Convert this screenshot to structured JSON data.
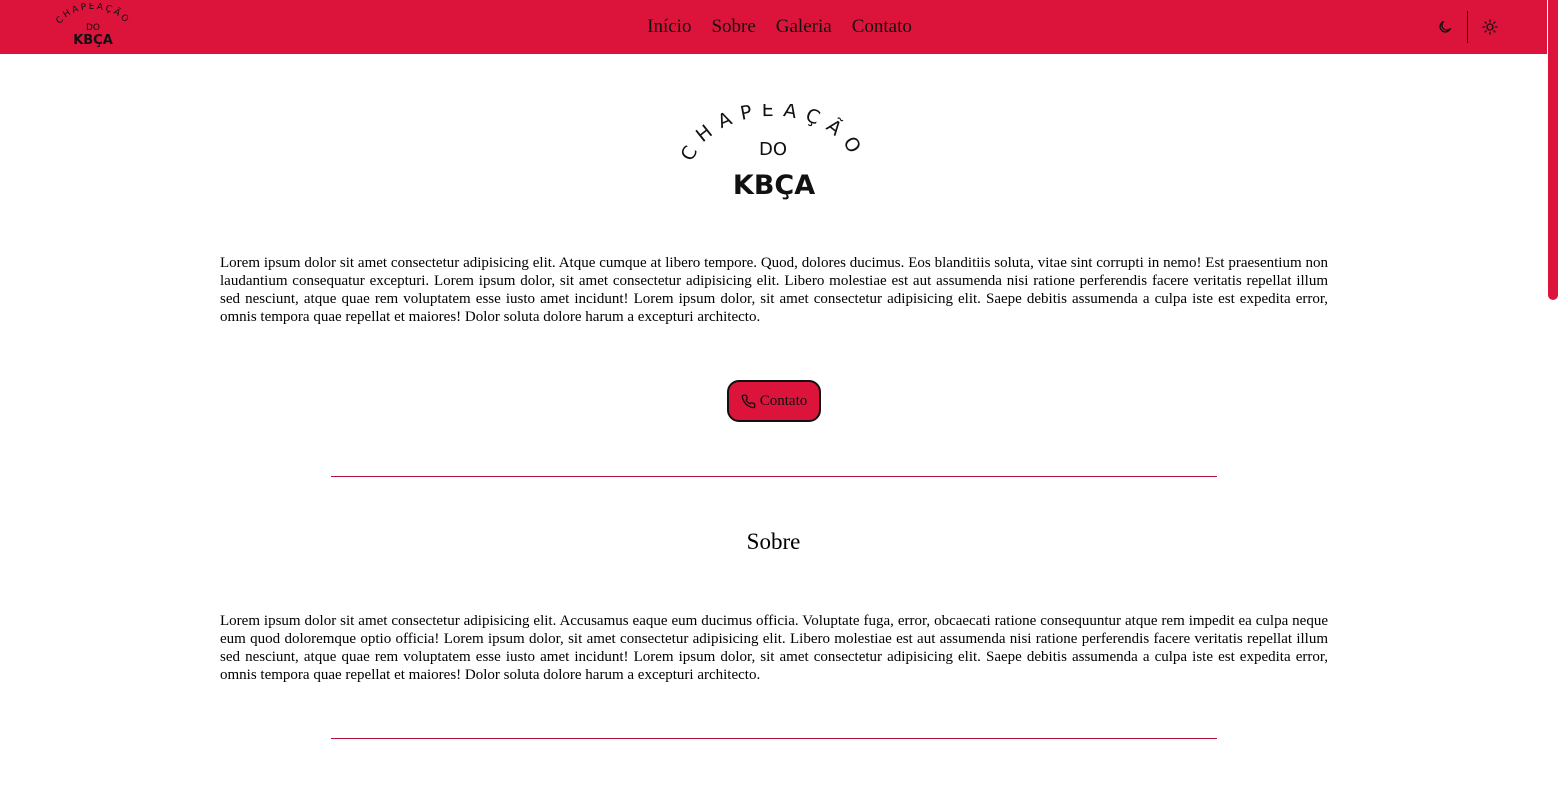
{
  "brand": {
    "arc_text": "CHAPEAÇÃO",
    "middle_text": "DO",
    "bold_text": "KBÇA"
  },
  "nav": {
    "items": [
      {
        "label": "Início"
      },
      {
        "label": "Sobre"
      },
      {
        "label": "Galeria"
      },
      {
        "label": "Contato"
      }
    ]
  },
  "theme": {
    "dark_icon": "moon-icon",
    "light_icon": "sun-icon"
  },
  "hero": {
    "paragraph": "Lorem ipsum dolor sit amet consectetur adipisicing elit. Atque cumque at libero tempore. Quod, dolores ducimus. Eos blanditiis soluta, vitae sint corrupti in nemo! Est praesentium non laudantium consequatur excepturi. Lorem ipsum dolor, sit amet consectetur adipisicing elit. Libero molestiae est aut assumenda nisi ratione perferendis facere veritatis repellat illum sed nesciunt, atque quae rem voluptatem esse iusto amet incidunt! Lorem ipsum dolor, sit amet consectetur adipisicing elit. Saepe debitis assumenda a culpa iste est expedita error, omnis tempora quae repellat et maiores! Dolor soluta dolore harum a excepturi architecto.",
    "contact_button": "Contato",
    "contact_icon": "phone-icon"
  },
  "about": {
    "title": "Sobre",
    "paragraph": "Lorem ipsum dolor sit amet consectetur adipisicing elit. Accusamus eaque eum ducimus officia. Voluptate fuga, error, obcaecati ratione consequuntur atque rem impedit ea culpa neque eum quod doloremque optio officia! Lorem ipsum dolor, sit amet consectetur adipisicing elit. Libero molestiae est aut assumenda nisi ratione perferendis facere veritatis repellat illum sed nesciunt, atque quae rem voluptatem esse iusto amet incidunt! Lorem ipsum dolor, sit amet consectetur adipisicing elit. Saepe debitis assumenda a culpa iste est expedita error, omnis tempora quae repellat et maiores! Dolor soluta dolore harum a excepturi architecto."
  },
  "colors": {
    "accent": "#dc143c",
    "text": "#111111",
    "background": "#ffffff"
  }
}
